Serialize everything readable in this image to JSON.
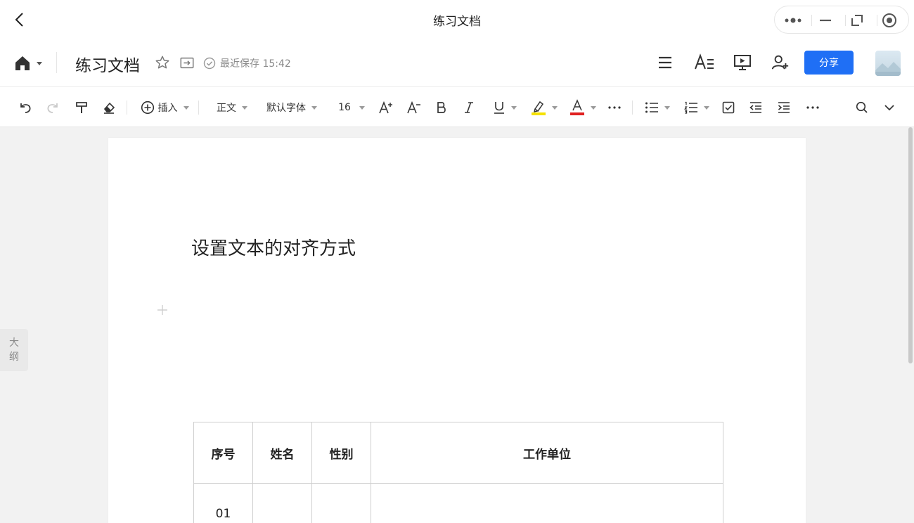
{
  "window": {
    "title": "练习文档"
  },
  "header": {
    "doc_title": "练习文档",
    "save_status": "最近保存 15:42",
    "share_label": "分享"
  },
  "toolbar": {
    "insert_label": "插入",
    "style_label": "正文",
    "font_label": "默认字体",
    "size_label": "16",
    "highlight_color": "#f5e100",
    "font_color": "#e02020"
  },
  "outline": {
    "label_1": "大",
    "label_2": "纲"
  },
  "document": {
    "heading": "设置文本的对齐方式",
    "table": {
      "headers": [
        "序号",
        "姓名",
        "性别",
        "工作单位"
      ],
      "rows": [
        [
          "01",
          "",
          "",
          ""
        ]
      ]
    }
  },
  "colors": {
    "accent": "#1f6ff5",
    "canvas_bg": "#f2f2f2"
  }
}
